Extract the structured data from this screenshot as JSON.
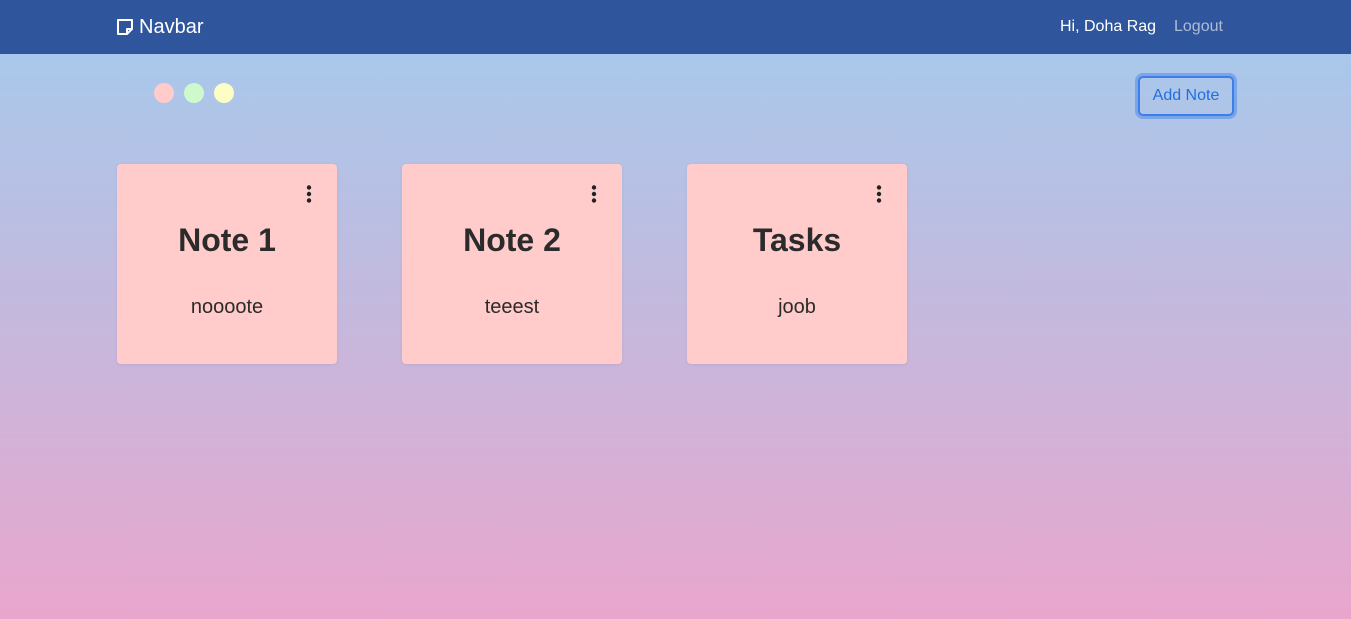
{
  "navbar": {
    "brand": "Navbar",
    "brand_icon": "sticky-note-icon",
    "greeting": "Hi, Doha Rag",
    "logout_label": "Logout",
    "background": "#2f569c"
  },
  "color_picker": [
    {
      "name": "pink",
      "color": "#ffcbcb"
    },
    {
      "name": "green",
      "color": "#cdf9cd"
    },
    {
      "name": "yellow",
      "color": "#fdfdc6"
    }
  ],
  "add_note_label": "Add Note",
  "notes": [
    {
      "title": "Note 1",
      "body": "noooote",
      "color": "#ffcbcb",
      "menu_icon": "kebab-menu-icon"
    },
    {
      "title": "Note 2",
      "body": "teeest",
      "color": "#ffcbcb",
      "menu_icon": "kebab-menu-icon"
    },
    {
      "title": "Tasks",
      "body": "joob",
      "color": "#ffcbcb",
      "menu_icon": "kebab-menu-icon"
    }
  ]
}
